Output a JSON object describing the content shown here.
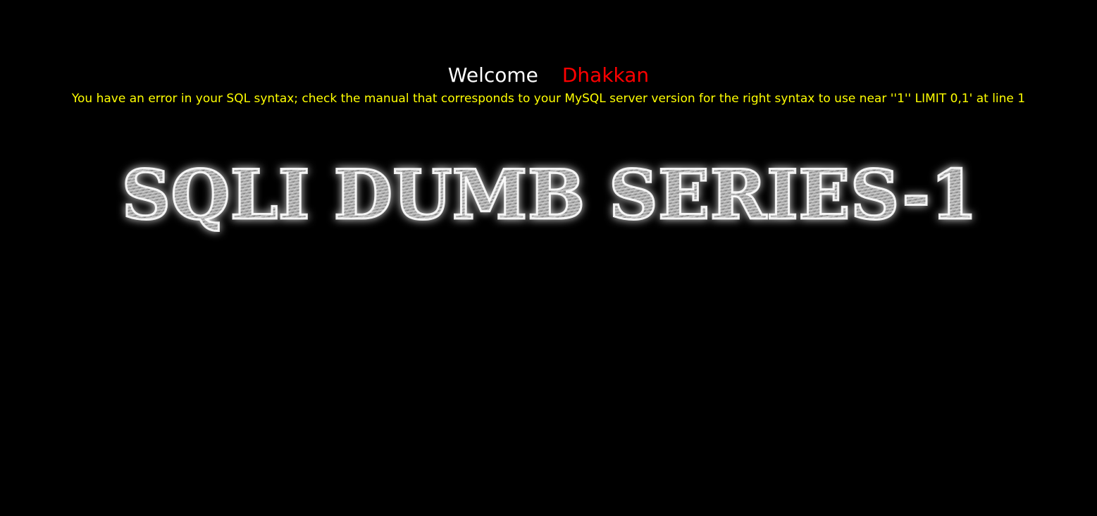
{
  "welcome": {
    "greeting": "Welcome",
    "name": "Dhakkan"
  },
  "error": {
    "message": "You have an error in your SQL syntax; check the manual that corresponds to your MySQL server version for the right syntax to use near ''1'' LIMIT 0,1' at line 1"
  },
  "banner": {
    "text": "SQLI DUMB SERIES-1"
  },
  "colors": {
    "background": "#000000",
    "greeting": "#ffffff",
    "name": "#ff0000",
    "error": "#ffff00"
  }
}
